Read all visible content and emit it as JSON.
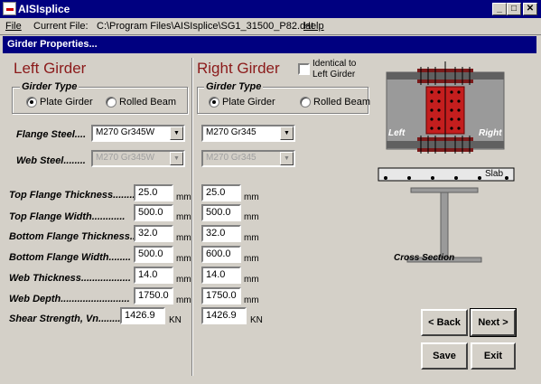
{
  "window": {
    "title": "AISIsplice",
    "minimize": "_",
    "maximize": "□",
    "close": "✕"
  },
  "menu": {
    "file": "File",
    "current_file_label": "Current File:",
    "current_file_path": "C:\\Program Files\\AISIsplice\\SG1_31500_P82.dat",
    "help": "Help"
  },
  "panel_title": "Girder Properties...",
  "left": {
    "heading": "Left Girder",
    "girder_type_label": "Girder Type",
    "plate": "Plate Girder",
    "rolled": "Rolled Beam",
    "flange_steel": "M270 Gr345W",
    "web_steel": "M270 Gr345W",
    "values": [
      "25.0",
      "500.0",
      "32.0",
      "500.0",
      "14.0",
      "1750.0",
      "1426.9"
    ]
  },
  "right": {
    "heading": "Right Girder",
    "identical_label": "Identical to Left Girder",
    "girder_type_label": "Girder Type",
    "plate": "Plate Girder",
    "rolled": "Rolled Beam",
    "flange_steel": "M270 Gr345",
    "web_steel": "M270 Gr345",
    "values": [
      "25.0",
      "500.0",
      "32.0",
      "600.0",
      "14.0",
      "1750.0",
      "1426.9"
    ]
  },
  "labels": {
    "flange_steel": "Flange Steel....",
    "web_steel": "Web Steel........",
    "top_flange_thickness": "Top Flange Thickness........",
    "top_flange_width": "Top Flange Width............",
    "bottom_flange_thickness": "Bottom Flange Thickness..",
    "bottom_flange_width": "Bottom Flange Width........",
    "web_thickness": "Web Thickness..................",
    "web_depth": "Web Depth.........................",
    "shear_strength": "Shear Strength, Vn........"
  },
  "units": {
    "mm": "mm",
    "kn": "KN"
  },
  "diagram": {
    "left": "Left",
    "right": "Right",
    "slab": "Slab",
    "cross_section": "Cross Section"
  },
  "buttons": {
    "back": "< Back",
    "next": "Next >",
    "save": "Save",
    "exit": "Exit"
  }
}
